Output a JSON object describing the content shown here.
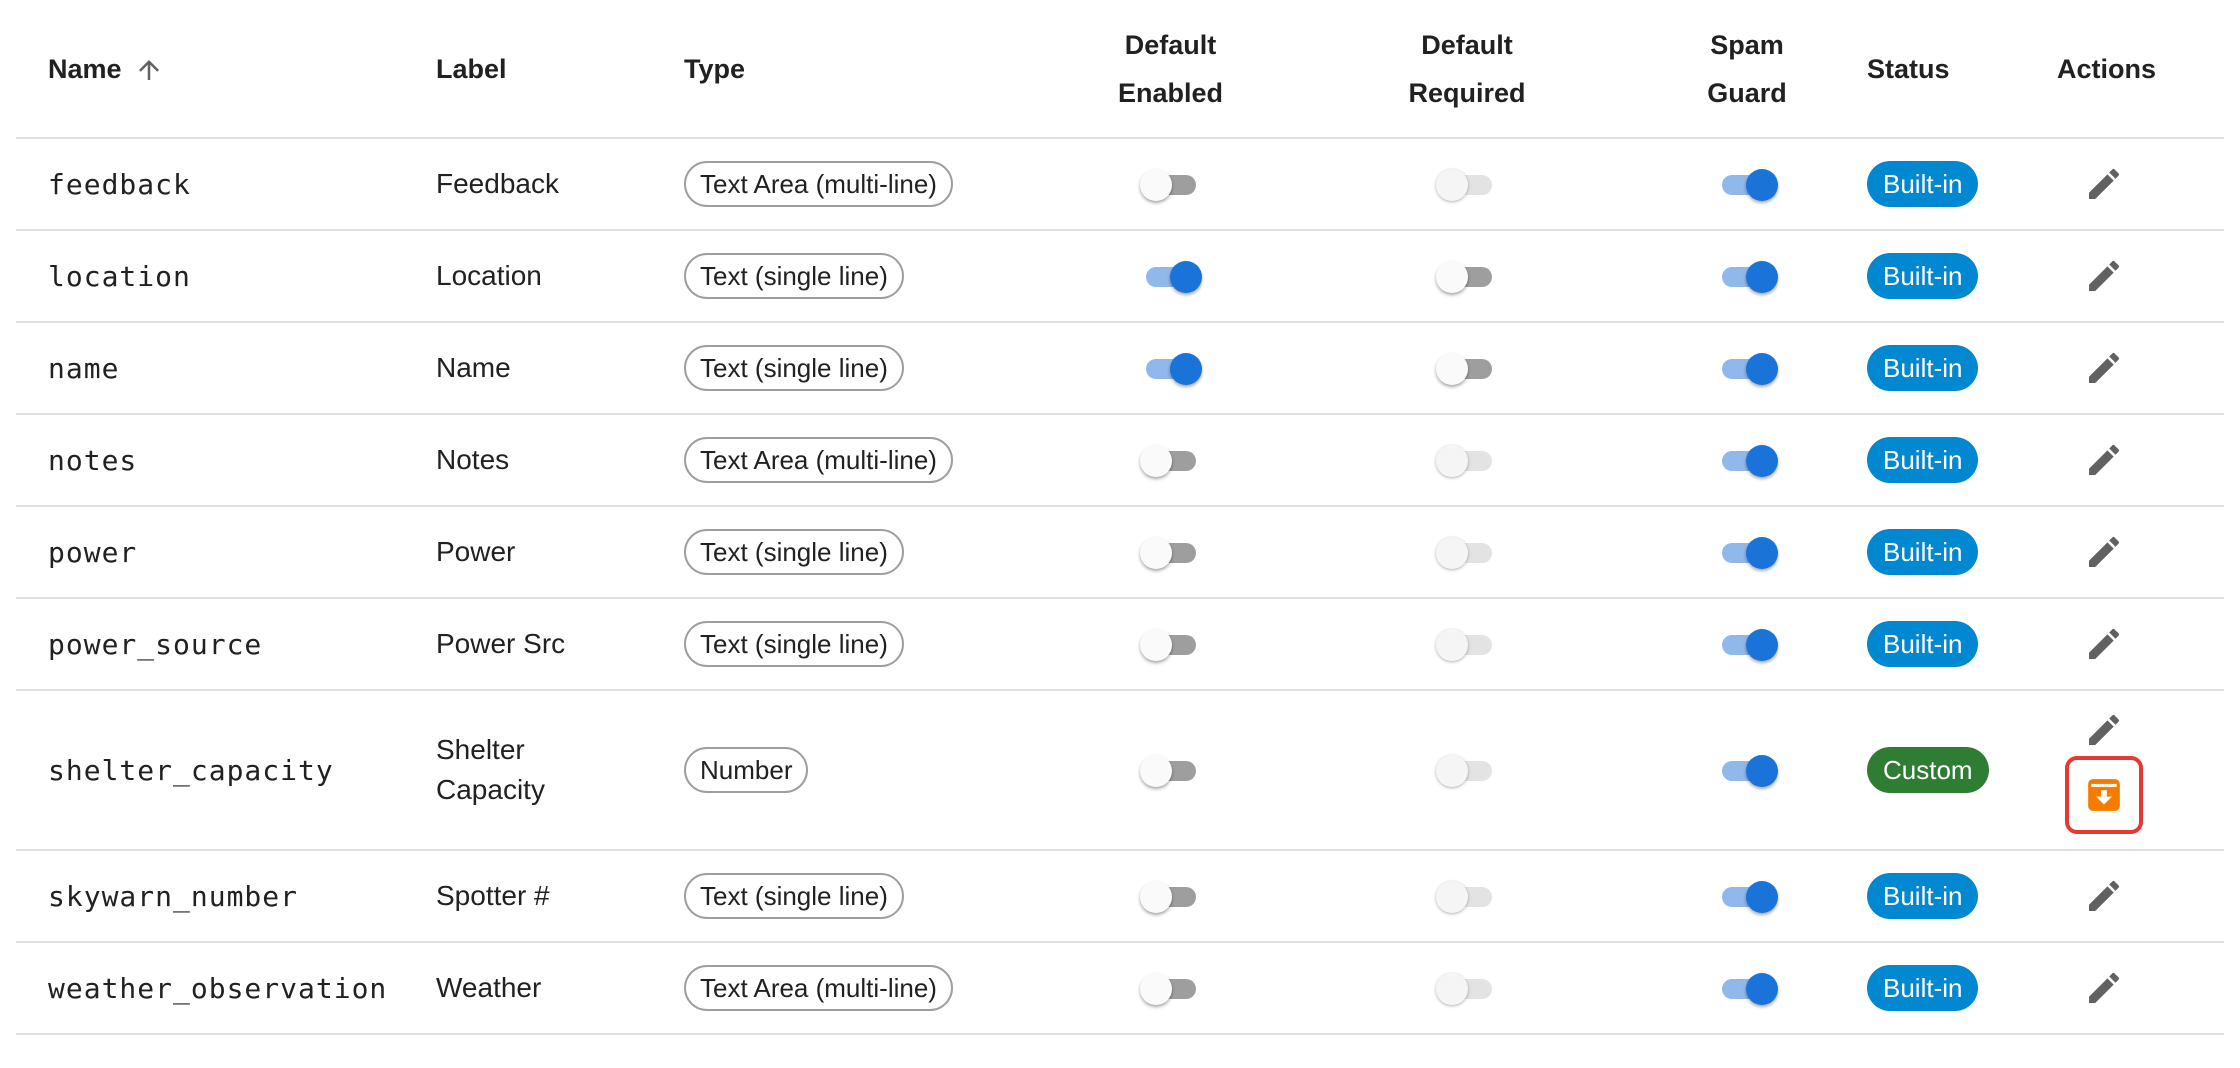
{
  "columns": {
    "name": "Name",
    "label": "Label",
    "type": "Type",
    "default_enabled_line1": "Default",
    "default_enabled_line2": "Enabled",
    "default_required_line1": "Default",
    "default_required_line2": "Required",
    "spam_guard_line1": "Spam",
    "spam_guard_line2": "Guard",
    "status": "Status",
    "actions": "Actions"
  },
  "sort": {
    "column": "name",
    "direction": "ascending",
    "icon": "arrow-up-icon"
  },
  "icons": {
    "edit": "pencil-icon",
    "archive": "archive-icon"
  },
  "colors": {
    "toggle_on": "#1a73d9",
    "builtin_badge": "#0288d1",
    "custom_badge": "#2e7d32",
    "archive_button": "#f57c00",
    "highlight_border": "#e53935"
  },
  "rows": [
    {
      "name": "feedback",
      "label": "Feedback",
      "type": "Text Area (multi-line)",
      "default_enabled": false,
      "default_required": false,
      "default_required_disabled": true,
      "spam_guard": true,
      "status": "Built-in"
    },
    {
      "name": "location",
      "label": "Location",
      "type": "Text (single line)",
      "default_enabled": true,
      "default_required": false,
      "default_required_disabled": false,
      "spam_guard": true,
      "status": "Built-in"
    },
    {
      "name": "name",
      "label": "Name",
      "type": "Text (single line)",
      "default_enabled": true,
      "default_required": false,
      "default_required_disabled": false,
      "spam_guard": true,
      "status": "Built-in"
    },
    {
      "name": "notes",
      "label": "Notes",
      "type": "Text Area (multi-line)",
      "default_enabled": false,
      "default_required": false,
      "default_required_disabled": true,
      "spam_guard": true,
      "status": "Built-in"
    },
    {
      "name": "power",
      "label": "Power",
      "type": "Text (single line)",
      "default_enabled": false,
      "default_required": false,
      "default_required_disabled": true,
      "spam_guard": true,
      "status": "Built-in"
    },
    {
      "name": "power_source",
      "label": "Power Src",
      "type": "Text (single line)",
      "default_enabled": false,
      "default_required": false,
      "default_required_disabled": true,
      "spam_guard": true,
      "status": "Built-in"
    },
    {
      "name": "shelter_capacity",
      "label": "Shelter Capacity",
      "type": "Number",
      "default_enabled": false,
      "default_required": false,
      "default_required_disabled": true,
      "spam_guard": true,
      "status": "Custom"
    },
    {
      "name": "skywarn_number",
      "label": "Spotter #",
      "type": "Text (single line)",
      "default_enabled": false,
      "default_required": false,
      "default_required_disabled": true,
      "spam_guard": true,
      "status": "Built-in"
    },
    {
      "name": "weather_observation",
      "label": "Weather",
      "type": "Text Area (multi-line)",
      "default_enabled": false,
      "default_required": false,
      "default_required_disabled": true,
      "spam_guard": true,
      "status": "Built-in"
    }
  ]
}
